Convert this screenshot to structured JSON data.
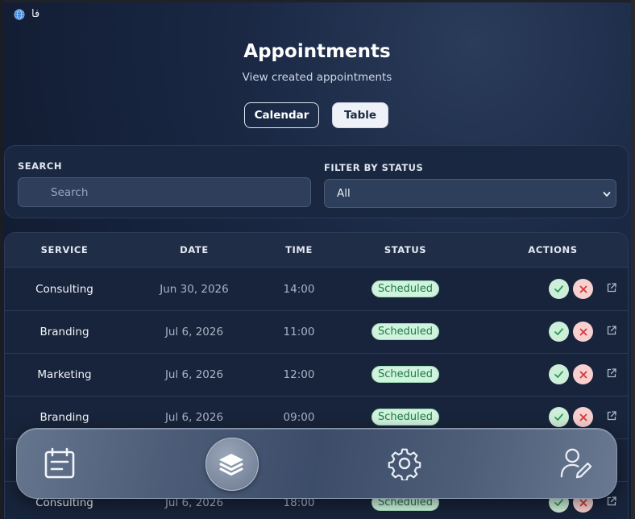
{
  "lang": {
    "icon": "globe-icon",
    "label": "فا"
  },
  "header": {
    "title": "Appointments",
    "subtitle": "View created appointments"
  },
  "view_toggle": {
    "calendar_label": "Calendar",
    "table_label": "Table",
    "active": "Table"
  },
  "filters": {
    "search_label": "SEARCH",
    "search_placeholder": "Search",
    "status_label": "FILTER BY STATUS",
    "status_value": "All"
  },
  "table": {
    "columns": [
      "SERVICE",
      "DATE",
      "TIME",
      "STATUS",
      "ACTIONS"
    ],
    "rows": [
      {
        "service": "Consulting",
        "date": "Jun 30, 2026",
        "time": "14:00",
        "status": "Scheduled"
      },
      {
        "service": "Branding",
        "date": "Jul 6, 2026",
        "time": "11:00",
        "status": "Scheduled"
      },
      {
        "service": "Marketing",
        "date": "Jul 6, 2026",
        "time": "12:00",
        "status": "Scheduled"
      },
      {
        "service": "Branding",
        "date": "Jul 6, 2026",
        "time": "09:00",
        "status": "Scheduled"
      },
      {
        "service": "",
        "date": "",
        "time": "",
        "status": ""
      },
      {
        "service": "Consulting",
        "date": "Jul 6, 2026",
        "time": "18:00",
        "status": "Scheduled"
      }
    ]
  },
  "dock": {
    "items": [
      {
        "icon": "calendar-list-icon",
        "active": false
      },
      {
        "icon": "layers-icon",
        "active": true
      },
      {
        "icon": "gear-icon",
        "active": false
      },
      {
        "icon": "user-edit-icon",
        "active": false
      }
    ]
  },
  "colors": {
    "background": "#131e35",
    "card": "#1a2740",
    "badge_bg": "#cff3dd",
    "badge_text": "#1f7a45",
    "accept": "#cdeed8",
    "reject": "#f8d0d0"
  }
}
